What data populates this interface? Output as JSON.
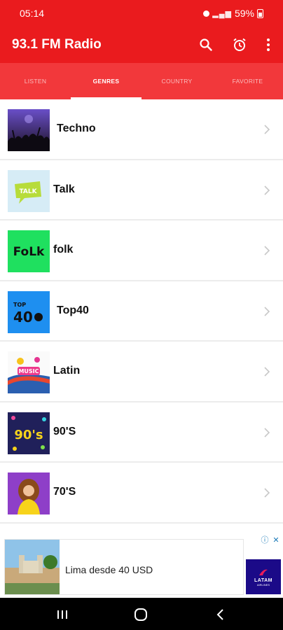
{
  "status": {
    "time": "05:14",
    "battery": "59%"
  },
  "app": {
    "title": "93.1 FM Radio"
  },
  "tabs": [
    {
      "label": "LISTEN",
      "active": false
    },
    {
      "label": "GENRES",
      "active": true
    },
    {
      "label": "COUNTRY",
      "active": false
    },
    {
      "label": "FAVORITE",
      "active": false
    }
  ],
  "genres": [
    {
      "label": "Techno"
    },
    {
      "label": "Talk"
    },
    {
      "label": "folk"
    },
    {
      "label": "Top40"
    },
    {
      "label": "Latin"
    },
    {
      "label": "90'S"
    },
    {
      "label": "70'S"
    }
  ],
  "thumbs": {
    "talk": "TALK",
    "folk": "FoLk",
    "top": "TOP",
    "top_num": "40",
    "latin": "MUSIC",
    "nineties": "90's"
  },
  "ad": {
    "text": "Lima desde 40 USD",
    "brand": "LATAM",
    "brand_sub": "AIRLINES"
  },
  "colors": {
    "primary": "#ea1b1e",
    "tabs": "#f2383b"
  }
}
